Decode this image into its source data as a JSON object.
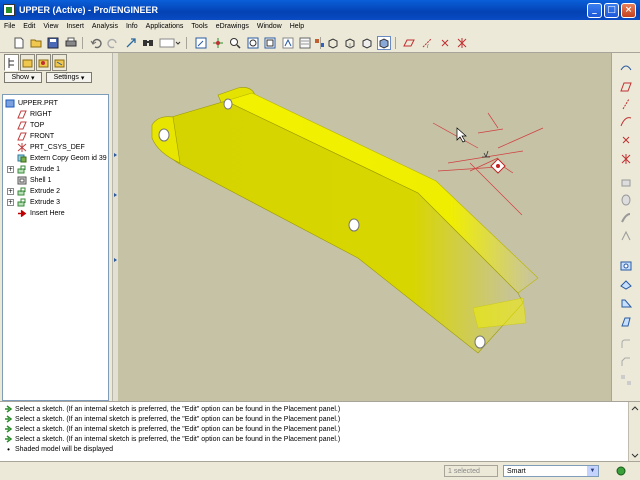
{
  "window": {
    "title": "UPPER (Active) - Pro/ENGINEER",
    "minimize": "_",
    "maximize": "□",
    "close": "×"
  },
  "menu": [
    "File",
    "Edit",
    "View",
    "Insert",
    "Analysis",
    "Info",
    "Applications",
    "Tools",
    "eDrawings",
    "Window",
    "Help"
  ],
  "navigator": {
    "show_label": "Show",
    "settings_label": "Settings",
    "tree": [
      {
        "label": "UPPER.PRT",
        "icon": "part-icon",
        "color": "#1a5ab8"
      },
      {
        "label": "RIGHT",
        "icon": "datum-plane-icon",
        "color": "#c04040"
      },
      {
        "label": "TOP",
        "icon": "datum-plane-icon",
        "color": "#c04040"
      },
      {
        "label": "FRONT",
        "icon": "datum-plane-icon",
        "color": "#c04040"
      },
      {
        "label": "PRT_CSYS_DEF",
        "icon": "csys-icon",
        "color": "#c04040"
      },
      {
        "label": "Extern Copy Geom id 39",
        "icon": "copy-geom-icon",
        "color": "#2a7a9a"
      },
      {
        "label": "Extrude 1",
        "icon": "extrude-icon",
        "color": "#3a8a3a"
      },
      {
        "label": "Shell 1",
        "icon": "shell-icon",
        "color": "#555555"
      },
      {
        "label": "Extrude 2",
        "icon": "extrude-icon",
        "color": "#3a8a3a"
      },
      {
        "label": "Extrude 3",
        "icon": "extrude-icon",
        "color": "#3a8a3a"
      },
      {
        "label": "Insert Here",
        "icon": "insert-arrow-icon",
        "color": "#c00000"
      }
    ]
  },
  "messages": [
    "Select a sketch. (If an internal sketch is preferred, the \"Edit\" option can be found in the Placement panel.)",
    "Select a sketch. (If an internal sketch is preferred, the \"Edit\" option can be found in the Placement panel.)",
    "Select a sketch. (If an internal sketch is preferred, the \"Edit\" option can be found in the Placement panel.)",
    "Select a sketch. (If an internal sketch is preferred, the \"Edit\" option can be found in the Placement panel.)",
    "Shaded model will be displayed"
  ],
  "status": {
    "selected": "1 selected",
    "filter": "Smart"
  },
  "colors": {
    "model": "#f2f200",
    "background": "#c6c2a6",
    "datum": "#d04040"
  }
}
